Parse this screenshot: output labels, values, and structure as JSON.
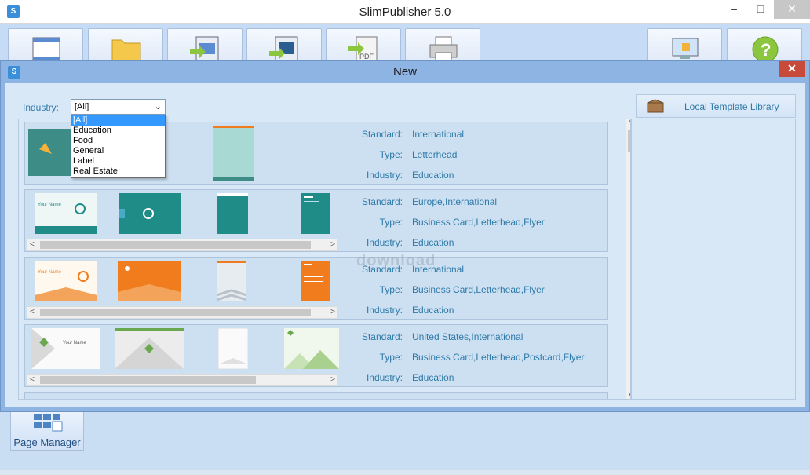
{
  "window": {
    "title": "SlimPublisher 5.0",
    "app_icon": "S",
    "minimize": "–",
    "maximize": "□",
    "close": "✕"
  },
  "toolbar": [
    {
      "name": "new-icon"
    },
    {
      "name": "open-folder-icon"
    },
    {
      "name": "import-image-icon"
    },
    {
      "name": "export-image-icon"
    },
    {
      "name": "export-pdf-icon"
    },
    {
      "name": "print-icon"
    },
    {
      "name": "settings-icon"
    },
    {
      "name": "help-icon"
    }
  ],
  "page_manager": {
    "label": "Page Manager"
  },
  "dialog": {
    "title": "New",
    "app_icon": "S",
    "close": "✕",
    "industry_label": "Industry:",
    "industry_value": "[All]",
    "industry_options": [
      "[All]",
      "Education",
      "Food",
      "General",
      "Label",
      "Real Estate"
    ],
    "library_button": "Local Template Library",
    "watermark": "download",
    "labels": {
      "standard": "Standard:",
      "type": "Type:",
      "industry": "Industry:"
    },
    "templates": [
      {
        "standard": "International",
        "type": "Letterhead",
        "industry": "Education"
      },
      {
        "standard": "Europe,International",
        "type": "Business Card,Letterhead,Flyer",
        "industry": "Education"
      },
      {
        "standard": "International",
        "type": "Business Card,Letterhead,Flyer",
        "industry": "Education"
      },
      {
        "standard": "United States,International",
        "type": "Business Card,Letterhead,Postcard,Flyer",
        "industry": "Education"
      }
    ]
  },
  "colors": {
    "accent": "#2e7aa8",
    "teal": "#1f8c88",
    "orange": "#f07c1e",
    "selection": "#3399ff"
  }
}
